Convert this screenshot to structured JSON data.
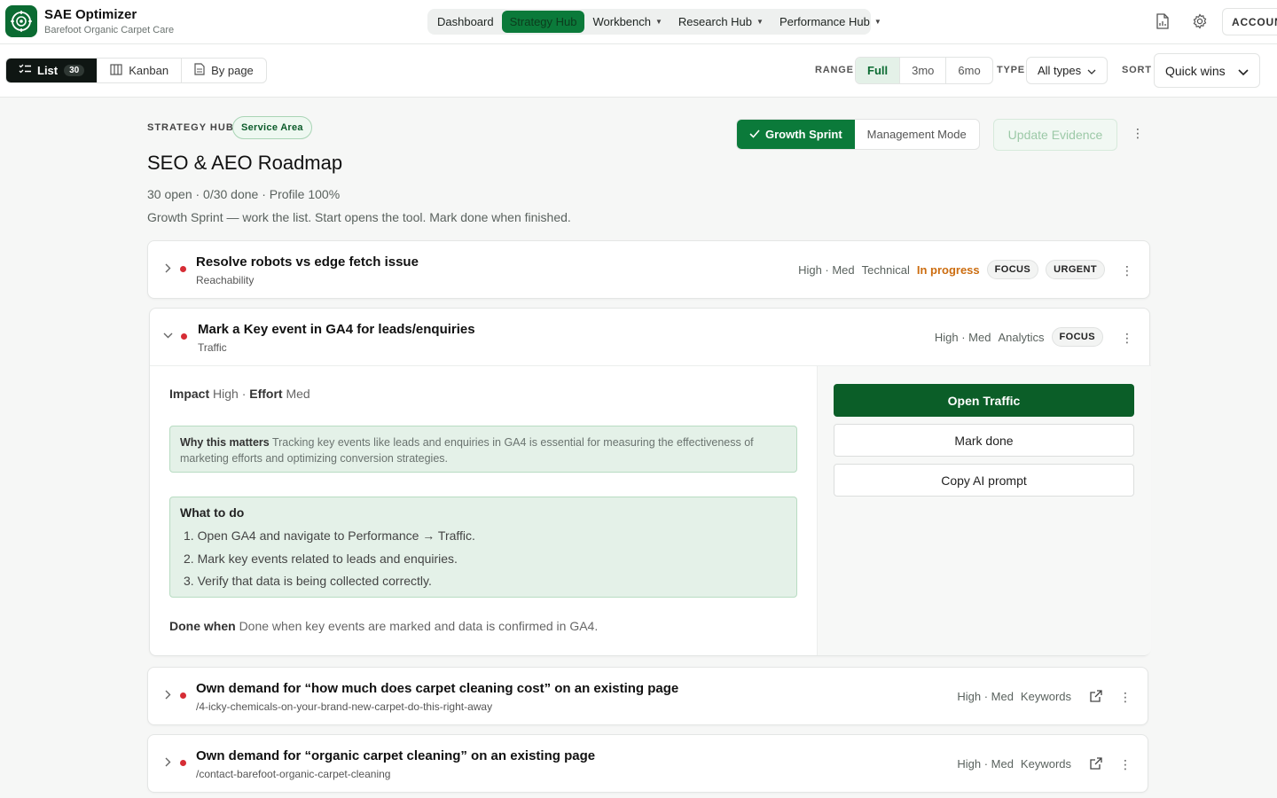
{
  "app": {
    "name": "SAE Optimizer",
    "client": "Barefoot Organic Carpet Care"
  },
  "nav": {
    "items": [
      {
        "label": "Dashboard",
        "active": false,
        "has_menu": false
      },
      {
        "label": "Strategy Hub",
        "active": true,
        "has_menu": false
      },
      {
        "label": "Workbench",
        "active": false,
        "has_menu": true
      },
      {
        "label": "Research Hub",
        "active": false,
        "has_menu": true
      },
      {
        "label": "Performance Hub",
        "active": false,
        "has_menu": true
      }
    ],
    "account_label": "ACCOUN"
  },
  "toolbar": {
    "views": [
      {
        "label": "List",
        "count": "30",
        "active": true,
        "icon": "list-icon"
      },
      {
        "label": "Kanban",
        "active": false,
        "icon": "columns-icon"
      },
      {
        "label": "By page",
        "active": false,
        "icon": "page-icon"
      }
    ],
    "range_label": "RANGE",
    "range_options": [
      "Full",
      "3mo",
      "6mo"
    ],
    "range_selected": "Full",
    "type_label": "TYPE",
    "type_value": "All types",
    "sort_label": "SORT",
    "sort_value": "Quick wins"
  },
  "header": {
    "eyebrow": "STRATEGY HUB",
    "badge": "Service Area",
    "title": "SEO & AEO Roadmap",
    "meta": "30 open · 0/30 done · Profile 100%",
    "description": "Growth Sprint — work the list. Start opens the tool. Mark done when finished.",
    "modes": [
      "Growth Sprint",
      "Management Mode"
    ],
    "mode_selected": "Growth Sprint",
    "update_label": "Update Evidence"
  },
  "tasks": [
    {
      "title": "Resolve robots vs edge fetch issue",
      "subtitle": "Reachability",
      "impact_effort": "High · Med",
      "category": "Technical",
      "status": "In progress",
      "tags": [
        "FOCUS",
        "URGENT"
      ]
    },
    {
      "title": "Mark a Key event in GA4 for leads/enquiries",
      "subtitle": "Traffic",
      "impact_effort": "High · Med",
      "category": "Analytics",
      "tags": [
        "FOCUS"
      ],
      "expanded": {
        "impact_label": "Impact",
        "impact_value": "High",
        "effort_label": "Effort",
        "effort_value": "Med",
        "why_label": "Why this matters",
        "why_text": "Tracking key events like leads and enquiries in GA4 is essential for measuring the effectiveness of marketing efforts and optimizing conversion strategies.",
        "todo_label": "What to do",
        "steps": [
          "1. Open GA4 and navigate to Performance → Traffic.",
          "2. Mark key events related to leads and enquiries.",
          "3. Verify that data is being collected correctly."
        ],
        "done_label": "Done when",
        "done_text": "Done when key events are marked and data is confirmed in GA4.",
        "primary_action": "Open Traffic",
        "mark_done": "Mark done",
        "copy_prompt": "Copy AI prompt"
      }
    },
    {
      "title": "Own demand for “how much does carpet cleaning cost” on an existing page",
      "subtitle": "/4-icky-chemicals-on-your-brand-new-carpet-do-this-right-away",
      "impact_effort": "High · Med",
      "category": "Keywords"
    },
    {
      "title": "Own demand for “organic carpet cleaning” on an existing page",
      "subtitle": "/contact-barefoot-organic-carpet-cleaning",
      "impact_effort": "High · Med",
      "category": "Keywords"
    }
  ],
  "colors": {
    "brand": "#0b7a3a",
    "primary_dark": "#0b5e28",
    "priority_dot": "#d62d35",
    "in_progress": "#cc6d10",
    "callout_bg": "#e4f1e8"
  }
}
